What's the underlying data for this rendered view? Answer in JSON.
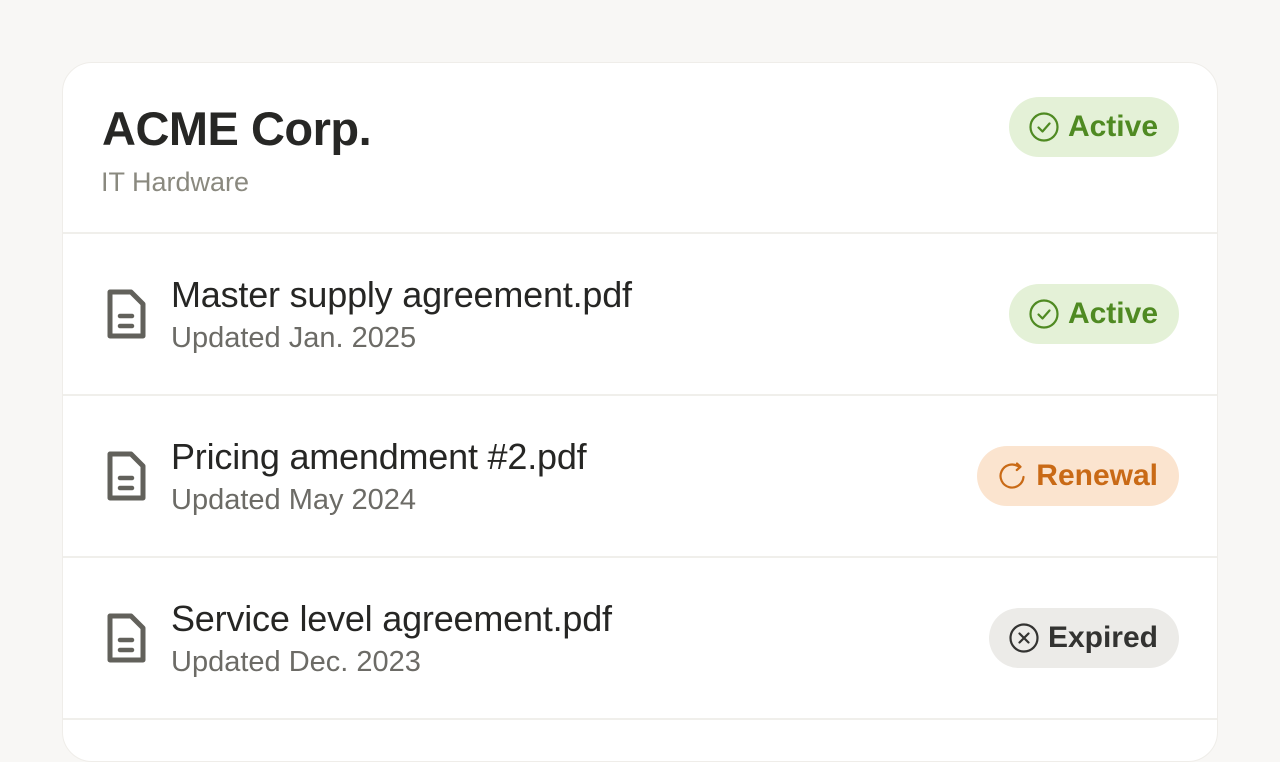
{
  "vendor": {
    "name": "ACME Corp.",
    "category": "IT Hardware",
    "status": {
      "label": "Active",
      "icon": "check-circle-icon",
      "tone": "active"
    }
  },
  "documents": [
    {
      "name": "Master supply agreement.pdf",
      "updated": "Updated Jan. 2025",
      "status": {
        "label": "Active",
        "icon": "check-circle-icon",
        "tone": "active"
      }
    },
    {
      "name": "Pricing amendment #2.pdf",
      "updated": "Updated May 2024",
      "status": {
        "label": "Renewal",
        "icon": "refresh-icon",
        "tone": "renewal"
      }
    },
    {
      "name": "Service level agreement.pdf",
      "updated": "Updated Dec. 2023",
      "status": {
        "label": "Expired",
        "icon": "x-circle-icon",
        "tone": "expired"
      }
    }
  ],
  "colors": {
    "active_bg": "#e4f1d7",
    "active_fg": "#4f8a22",
    "renewal_bg": "#fbe4cf",
    "renewal_fg": "#c96a16",
    "expired_bg": "#ecebe8",
    "expired_fg": "#333331"
  }
}
